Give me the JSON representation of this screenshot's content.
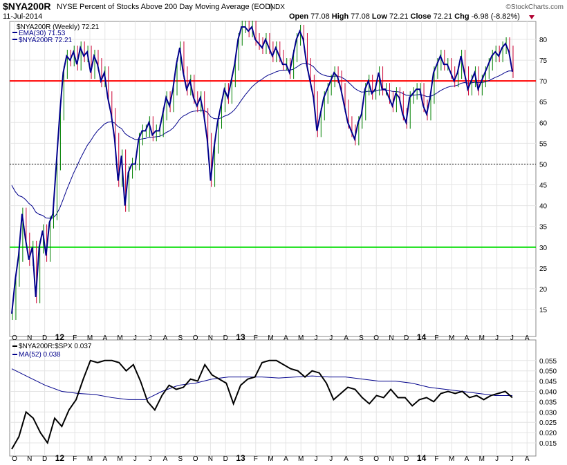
{
  "header": {
    "symbol": "$NYA200R",
    "description": "NYSE Percent of Stocks Above 200 Day Moving Average (EOD)",
    "exchange": "INDX",
    "watermark": "©StockCharts.com",
    "date": "11-Jul-2014",
    "open_label": "Open",
    "open": "77.08",
    "high_label": "High",
    "high": "77.08",
    "low_label": "Low",
    "low": "72.21",
    "close_label": "Close",
    "close": "72.21",
    "chg_label": "Chg",
    "chg": "-6.98 (-8.82%)"
  },
  "colors": {
    "price": "#00008b",
    "ema": "#00008b",
    "red_line": "#ff0000",
    "green_line": "#00dd00",
    "ratio": "#000000",
    "ma": "#00008b"
  },
  "chart_data": [
    {
      "type": "line",
      "title": "$NYA200R (Weekly) 72.21",
      "legend": [
        "$NYA200R (Weekly) 72.21",
        "EMA(30) 71.53",
        "$NYA200R 72.21"
      ],
      "ylim": [
        10,
        85
      ],
      "yticks": [
        15,
        20,
        25,
        30,
        35,
        40,
        45,
        50,
        55,
        60,
        65,
        70,
        75,
        80
      ],
      "hlines": {
        "red": 70,
        "green": 30,
        "dotted": 50
      },
      "ema_seed": 47,
      "closes": [
        14,
        22,
        28,
        38,
        32,
        27,
        30,
        18,
        30,
        34,
        28,
        36,
        38,
        50,
        62,
        72,
        76,
        75,
        77,
        74,
        78,
        76,
        77,
        72,
        76,
        74,
        70,
        72,
        66,
        62,
        56,
        46,
        52,
        40,
        48,
        50,
        50,
        56,
        58,
        58,
        60,
        57,
        58,
        58,
        62,
        66,
        64,
        68,
        74,
        78,
        72,
        68,
        70,
        66,
        64,
        66,
        62,
        56,
        46,
        54,
        60,
        64,
        68,
        66,
        70,
        74,
        80,
        83,
        83,
        82,
        83,
        80,
        79,
        78,
        80,
        78,
        76,
        78,
        76,
        74,
        74,
        72,
        76,
        80,
        82,
        80,
        74,
        70,
        66,
        58,
        62,
        66,
        68,
        70,
        72,
        71,
        68,
        64,
        60,
        58,
        56,
        60,
        62,
        68,
        70,
        67,
        68,
        72,
        68,
        68,
        66,
        64,
        67,
        66,
        62,
        60,
        66,
        67,
        68,
        68,
        64,
        62,
        66,
        72,
        74,
        76,
        74,
        74,
        72,
        70,
        72,
        76,
        72,
        68,
        70,
        72,
        68,
        70,
        72,
        74,
        76,
        77,
        76,
        78,
        79,
        77,
        72.21
      ]
    },
    {
      "type": "line",
      "legend": [
        "$NYA200R:$SPX 0.037",
        "MA(52) 0.038"
      ],
      "ylim": [
        0.011,
        0.058
      ],
      "yticks": [
        "0.015",
        "0.020",
        "0.025",
        "0.030",
        "0.035",
        "0.040",
        "0.045",
        "0.050",
        "0.055"
      ],
      "ratio": [
        0.012,
        0.018,
        0.03,
        0.027,
        0.02,
        0.015,
        0.027,
        0.023,
        0.031,
        0.036,
        0.046,
        0.055,
        0.054,
        0.055,
        0.055,
        0.054,
        0.05,
        0.053,
        0.045,
        0.035,
        0.031,
        0.038,
        0.043,
        0.041,
        0.042,
        0.046,
        0.045,
        0.053,
        0.048,
        0.046,
        0.044,
        0.034,
        0.043,
        0.046,
        0.047,
        0.054,
        0.055,
        0.055,
        0.053,
        0.051,
        0.05,
        0.047,
        0.05,
        0.049,
        0.044,
        0.036,
        0.039,
        0.042,
        0.041,
        0.037,
        0.034,
        0.038,
        0.037,
        0.041,
        0.037,
        0.037,
        0.033,
        0.036,
        0.037,
        0.035,
        0.039,
        0.04,
        0.039,
        0.04,
        0.037,
        0.038,
        0.036,
        0.038,
        0.039,
        0.04,
        0.037
      ],
      "ma": [
        0.051,
        0.047,
        0.043,
        0.04,
        0.039,
        0.0385,
        0.037,
        0.036,
        0.036,
        0.04,
        0.043,
        0.044,
        0.046,
        0.047,
        0.047,
        0.047,
        0.0465,
        0.047,
        0.0475,
        0.047,
        0.047,
        0.046,
        0.045,
        0.045,
        0.044,
        0.042,
        0.041,
        0.04,
        0.039,
        0.038,
        0.038
      ]
    }
  ],
  "months": [
    "O",
    "N",
    "D",
    "12",
    "F",
    "M",
    "A",
    "M",
    "J",
    "J",
    "A",
    "S",
    "O",
    "N",
    "D",
    "13",
    "F",
    "M",
    "A",
    "M",
    "J",
    "J",
    "A",
    "S",
    "O",
    "N",
    "D",
    "14",
    "F",
    "M",
    "A",
    "M",
    "J",
    "J",
    "A"
  ]
}
